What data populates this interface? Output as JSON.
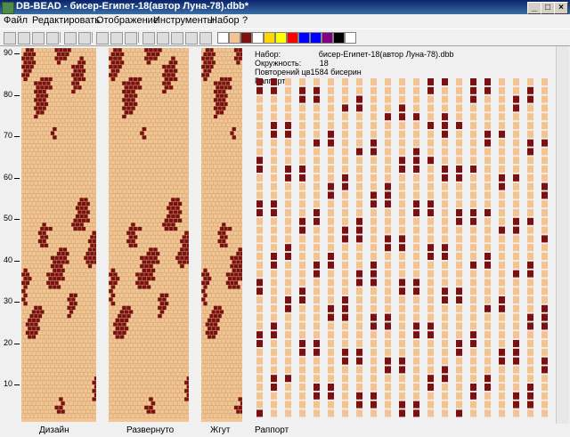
{
  "window": {
    "title": "DB-BEAD - бисер-Египет-18(автор Луна-78).dbb*"
  },
  "menu": [
    "Файл",
    "Редактировать",
    "Отображение",
    "Инструменты",
    "Набор",
    "?"
  ],
  "toolbar": {
    "icons": [
      "new-icon",
      "open-icon",
      "save-icon",
      "print-icon",
      "undo-icon",
      "redo-icon",
      "arrow-left-icon",
      "arrow-right-icon",
      "copy-icon",
      "pencil-icon",
      "select-icon",
      "fill-icon",
      "eyedropper-icon",
      "clear-icon"
    ],
    "colors": [
      "#ffffff",
      "#f2c491",
      "#7a1010",
      "#ffffff",
      "#ffd700",
      "#ffff00",
      "#ff0000",
      "#0000ff",
      "#0000ff",
      "#800080",
      "#000000",
      "#ffffff"
    ]
  },
  "ruler": {
    "ticks": [
      "90",
      "80",
      "70",
      "60",
      "50",
      "40",
      "30",
      "20",
      "10"
    ]
  },
  "info": {
    "set_label": "Набор:",
    "set_value": "бисер-Египет-18(автор Луна-78).dbb",
    "circ_label": "Окружность:",
    "circ_value": "18",
    "repeat_text": "Повторений цв1584 бисерин",
    "rapport_label": "Раппорт"
  },
  "bottom": {
    "design": "Дизайн",
    "unrolled": "Развернуто",
    "rope": "Жгут",
    "rapport": "Раппорт"
  },
  "colors": {
    "bead_light": "#f2c491",
    "bead_dark": "#7a1010",
    "grid": "#c8a070"
  }
}
